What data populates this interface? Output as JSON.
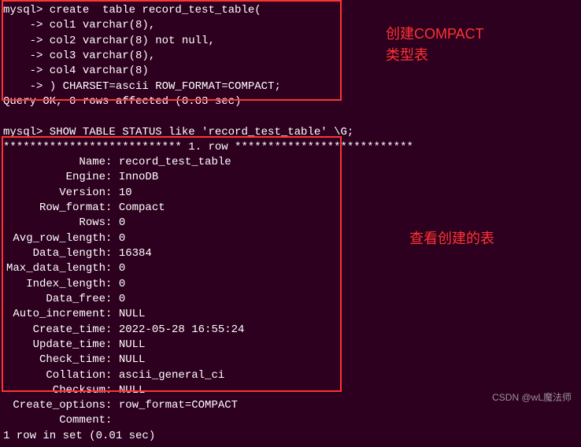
{
  "create": {
    "l1": "mysql> create  table record_test_table(",
    "l2": "    -> col1 varchar(8),",
    "l3": "    -> col2 varchar(8) not null,",
    "l4": "    -> col3 varchar(8),",
    "l5": "    -> col4 varchar(8)",
    "l6": "    -> ) CHARSET=ascii ROW_FORMAT=COMPACT;",
    "l7": "Query OK, 0 rows affected (0.03 sec)"
  },
  "show": {
    "cmd": "mysql> SHOW TABLE STATUS like 'record_test_table' \\G;",
    "sep": "*************************** 1. row ***************************"
  },
  "status": {
    "Name": "record_test_table",
    "Engine": "InnoDB",
    "Version": "10",
    "Row_format": "Compact",
    "Rows": "0",
    "Avg_row_length": "0",
    "Data_length": "16384",
    "Max_data_length": "0",
    "Index_length": "0",
    "Data_free": "0",
    "Auto_increment": "NULL",
    "Create_time": "2022-05-28 16:55:24",
    "Update_time": "NULL",
    "Check_time": "NULL",
    "Collation": "ascii_general_ci",
    "Checksum": "NULL",
    "Create_options": "row_format=COMPACT",
    "Comment": ""
  },
  "footer": "1 row in set (0.01 sec)",
  "annotations": {
    "a1_line1": "创建COMPACT",
    "a1_line2": "类型表",
    "a2": "查看创建的表"
  },
  "watermark": "CSDN @wL魔法师",
  "colors": {
    "bg": "#2c001e",
    "text": "#ffffff",
    "highlight": "#ff3333"
  }
}
